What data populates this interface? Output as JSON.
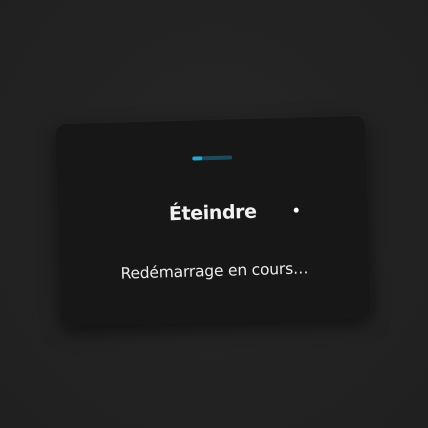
{
  "dialog": {
    "title": "Éteindre",
    "message": "Redémarrage en cours…",
    "progress": 0.25,
    "progress_icon": "loading-progress-bar",
    "indicator_icon": "dot-indicator"
  },
  "colors": {
    "background": "#222222",
    "dialog_background": "#171717",
    "progress_track": "#1e4b5c",
    "progress_fill": "#2aa3cf",
    "text": "#f2f2f2"
  }
}
